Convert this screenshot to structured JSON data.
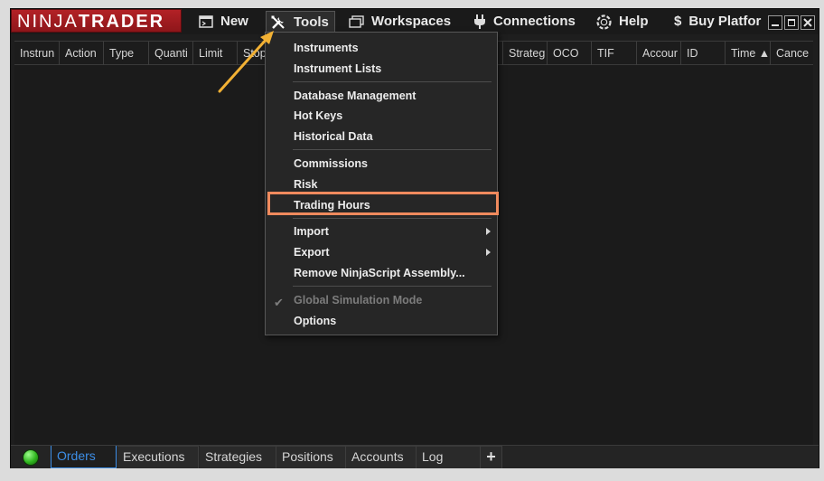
{
  "brand": {
    "part1": "NINJA",
    "part2": "TRADER"
  },
  "menubar": {
    "new_label": "New",
    "tools_label": "Tools",
    "workspaces_label": "Workspaces",
    "connections_label": "Connections",
    "help_label": "Help",
    "buy_label": "Buy Platfor"
  },
  "grid": {
    "columns": [
      "Instrun",
      "Action",
      "Type",
      "Quanti",
      "Limit",
      "Stop",
      "Strateg",
      "OCO",
      "TIF",
      "Accour",
      "ID",
      "Time ▲",
      "Cance"
    ]
  },
  "tools_menu": {
    "items": [
      "Instruments",
      "Instrument Lists",
      "Database Management",
      "Hot Keys",
      "Historical Data",
      "Commissions",
      "Risk",
      "Trading Hours",
      "Import",
      "Export",
      "Remove NinjaScript Assembly...",
      "Global Simulation Mode",
      "Options"
    ]
  },
  "tabs": [
    "Orders",
    "Executions",
    "Strategies",
    "Positions",
    "Accounts",
    "Log",
    "+"
  ],
  "colors": {
    "brand_red": "#b32126",
    "selected_tab": "#3d8ee6",
    "highlight": "#f08a5d",
    "annotation_arrow": "#f2b134",
    "status_led": "#2fb51e"
  },
  "icons": {
    "new": "new-window-icon",
    "tools": "tools-icon",
    "workspaces": "workspaces-icon",
    "connections": "plug-icon",
    "help": "help-lifebuoy-icon",
    "buy": "dollar-icon"
  }
}
